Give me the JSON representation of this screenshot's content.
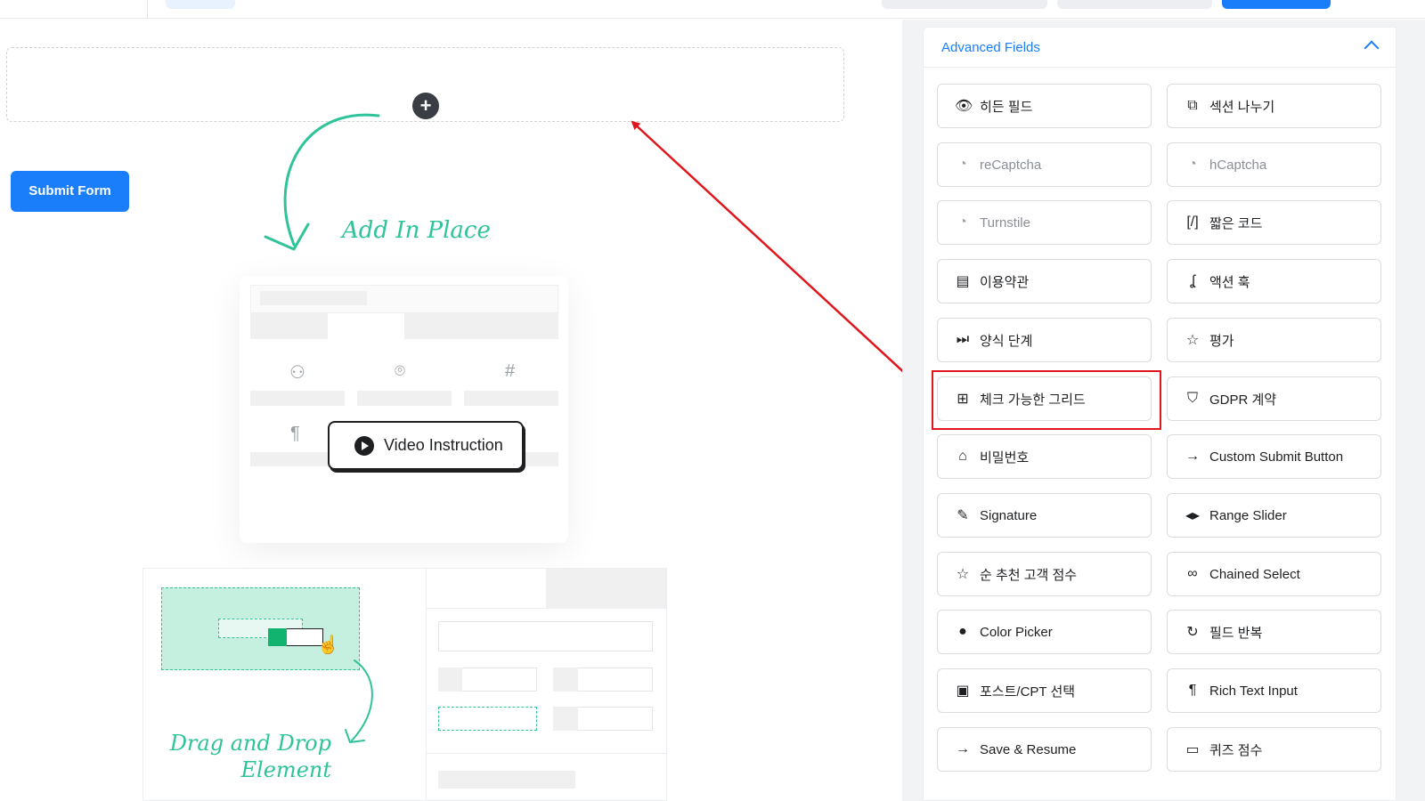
{
  "canvas": {
    "submit_label": "Submit Form",
    "add_in_place_label": "Add In Place",
    "video_label": "Video Instruction",
    "drag_drop_line1": "Drag and Drop",
    "drag_drop_line2": "Element"
  },
  "panel": {
    "title": "Advanced Fields",
    "fields": [
      {
        "label": "히든 필드",
        "icon": "eye-slash-icon",
        "glyph": "👁",
        "disabled": false
      },
      {
        "label": "섹션 나누기",
        "icon": "puzzle-icon",
        "glyph": "⧉",
        "disabled": false
      },
      {
        "label": "reCaptcha",
        "icon": "recaptcha-icon",
        "glyph": "◔",
        "disabled": true
      },
      {
        "label": "hCaptcha",
        "icon": "hcaptcha-icon",
        "glyph": "◔",
        "disabled": true
      },
      {
        "label": "Turnstile",
        "icon": "turnstile-icon",
        "glyph": "◔",
        "disabled": true
      },
      {
        "label": "짧은 코드",
        "icon": "shortcode-icon",
        "glyph": "[/]",
        "disabled": false
      },
      {
        "label": "이용약관",
        "icon": "document-icon",
        "glyph": "▤",
        "disabled": false
      },
      {
        "label": "액션 훅",
        "icon": "hook-icon",
        "glyph": "ʆ",
        "disabled": false
      },
      {
        "label": "양식 단계",
        "icon": "step-forward-icon",
        "glyph": "⏭",
        "disabled": false
      },
      {
        "label": "평가",
        "icon": "star-icon",
        "glyph": "☆",
        "disabled": false
      },
      {
        "label": "체크 가능한 그리드",
        "icon": "checkable-grid-icon",
        "glyph": "⊞",
        "disabled": false
      },
      {
        "label": "GDPR 계약",
        "icon": "shield-icon",
        "glyph": "⛉",
        "disabled": false
      },
      {
        "label": "비밀번호",
        "icon": "lock-icon",
        "glyph": "⌂",
        "disabled": false
      },
      {
        "label": "Custom Submit Button",
        "icon": "arrow-right-icon",
        "glyph": "→",
        "disabled": false
      },
      {
        "label": "Signature",
        "icon": "pen-icon",
        "glyph": "✎",
        "disabled": false
      },
      {
        "label": "Range Slider",
        "icon": "range-slider-icon",
        "glyph": "◂▸",
        "disabled": false
      },
      {
        "label": "순 추천 고객 점수",
        "icon": "star-outline-icon",
        "glyph": "☆",
        "disabled": false
      },
      {
        "label": "Chained Select",
        "icon": "link-icon",
        "glyph": "∞",
        "disabled": false
      },
      {
        "label": "Color Picker",
        "icon": "color-drop-icon",
        "glyph": "●",
        "disabled": false
      },
      {
        "label": "필드 반복",
        "icon": "repeat-icon",
        "glyph": "↻",
        "disabled": false
      },
      {
        "label": "포스트/CPT 선택",
        "icon": "post-select-icon",
        "glyph": "▣",
        "disabled": false
      },
      {
        "label": "Rich Text Input",
        "icon": "paragraph-icon",
        "glyph": "¶",
        "disabled": false
      },
      {
        "label": "Save & Resume",
        "icon": "arrow-right-icon",
        "glyph": "→",
        "disabled": false
      },
      {
        "label": "퀴즈 점수",
        "icon": "quiz-score-icon",
        "glyph": "▭",
        "disabled": false
      }
    ]
  },
  "colors": {
    "accent": "#1a7efb",
    "highlight": "#e0161c",
    "illustration_green": "#2fc39a"
  }
}
